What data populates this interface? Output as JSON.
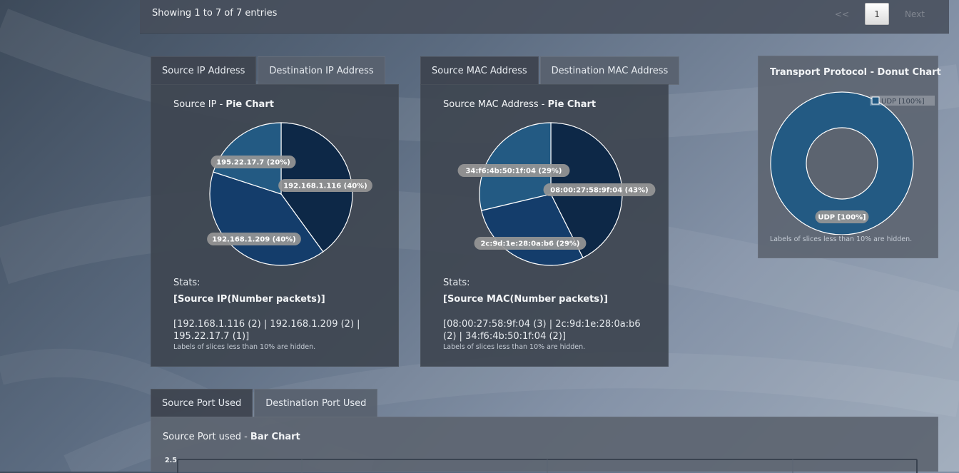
{
  "table_info": {
    "showing": "Showing 1 to 7 of 7 entries",
    "pager": {
      "prev": "<<",
      "current_page": "1",
      "next": "Next"
    }
  },
  "ip_panel": {
    "tabs": [
      "Source IP Address",
      "Destination IP Address"
    ],
    "title_prefix": "Source IP - ",
    "title_bold": "Pie Chart",
    "stats_label": "Stats:",
    "stats_head": "[Source IP(Number packets)]",
    "stats_values": "[192.168.1.116 (2) | 192.168.1.209 (2) | 195.22.17.7 (1)]",
    "note": "Labels of slices less than 10% are hidden.",
    "chart_data": {
      "type": "pie",
      "slices": [
        {
          "label": "192.168.1.116 (40%)",
          "value": 40,
          "color": "#0d2847"
        },
        {
          "label": "192.168.1.209 (40%)",
          "value": 40,
          "color": "#143d6b"
        },
        {
          "label": "195.22.17.7 (20%)",
          "value": 20,
          "color": "#235a83"
        }
      ]
    }
  },
  "mac_panel": {
    "tabs": [
      "Source MAC Address",
      "Destination MAC Address"
    ],
    "title_prefix": "Source MAC Address - ",
    "title_bold": "Pie Chart",
    "stats_label": "Stats:",
    "stats_head": "[Source MAC(Number packets)]",
    "stats_values": "[08:00:27:58:9f:04 (3) | 2c:9d:1e:28:0a:b6 (2) | 34:f6:4b:50:1f:04 (2)]",
    "note": "Labels of slices less than 10% are hidden.",
    "chart_data": {
      "type": "pie",
      "slices": [
        {
          "label": "08:00:27:58:9f:04 (43%)",
          "value": 43,
          "color": "#0d2847"
        },
        {
          "label": "2c:9d:1e:28:0a:b6 (29%)",
          "value": 29,
          "color": "#143d6b"
        },
        {
          "label": "34:f6:4b:50:1f:04 (29%)",
          "value": 29,
          "color": "#235a83"
        }
      ]
    }
  },
  "transport_panel": {
    "title": "Transport Protocol - Donut Chart",
    "legend": "UDP [100%]",
    "note": "Labels of slices less than 10% are hidden.",
    "chart_data": {
      "type": "pie",
      "donut": true,
      "slices": [
        {
          "label": "UDP [100%]",
          "value": 100,
          "color": "#235a83"
        }
      ]
    }
  },
  "port_panel": {
    "tabs": [
      "Source Port Used",
      "Destination Port Used"
    ],
    "title_prefix": "Source Port used - ",
    "title_bold": "Bar Chart",
    "chart_data": {
      "type": "bar",
      "y_first_tick": "2.5"
    }
  }
}
